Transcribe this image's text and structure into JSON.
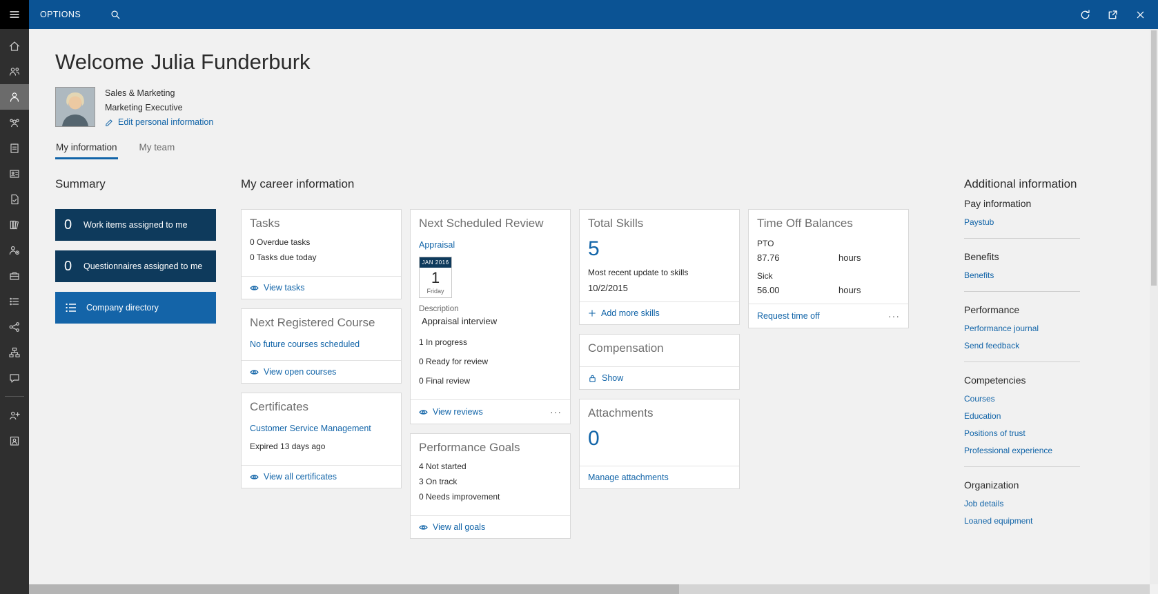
{
  "colors": {
    "topbar": "#0b5394",
    "sidebar": "#2f2f2f",
    "accent": "#1164a8",
    "tile_dark": "#0e3a5c",
    "tile_blue": "#1464a8",
    "background": "#f1f1f1"
  },
  "topbar": {
    "options_label": "OPTIONS"
  },
  "header": {
    "welcome": "Welcome",
    "user_name": "Julia Funderburk"
  },
  "profile": {
    "department": "Sales & Marketing",
    "job_title": "Marketing Executive",
    "edit_link": "Edit personal information"
  },
  "tabs": [
    {
      "label": "My information"
    },
    {
      "label": "My team"
    }
  ],
  "summary": {
    "heading": "Summary",
    "tiles": [
      {
        "count": "0",
        "label": "Work items assigned to me"
      },
      {
        "count": "0",
        "label": "Questionnaires assigned to me"
      },
      {
        "count": "",
        "label": "Company directory"
      }
    ]
  },
  "career": {
    "heading": "My career information",
    "tasks": {
      "title": "Tasks",
      "lines": [
        "0 Overdue tasks",
        "0 Tasks due today"
      ],
      "footer": "View tasks"
    },
    "next_course": {
      "title": "Next Registered Course",
      "link": "No future courses scheduled",
      "footer": "View open courses"
    },
    "certificates": {
      "title": "Certificates",
      "link": "Customer Service Management",
      "line": "Expired 13 days ago",
      "footer": "View all certificates"
    },
    "review": {
      "title": "Next Scheduled Review",
      "link": "Appraisal",
      "calendar": {
        "month": "JAN 2016",
        "day": "1",
        "weekday": "Friday"
      },
      "description_label": "Description",
      "description": "Appraisal interview",
      "lines": [
        "1 In progress",
        "0 Ready for review",
        "0 Final review"
      ],
      "footer": "View reviews",
      "more": "···"
    },
    "goals": {
      "title": "Performance Goals",
      "lines": [
        "4 Not started",
        "3 On track",
        "0 Needs improvement"
      ],
      "footer": "View all goals"
    },
    "skills": {
      "title": "Total Skills",
      "count": "5",
      "line": "Most recent update to skills",
      "date": "10/2/2015",
      "footer": "Add more skills"
    },
    "compensation": {
      "title": "Compensation",
      "footer": "Show"
    },
    "attachments": {
      "title": "Attachments",
      "count": "0",
      "footer": "Manage attachments"
    },
    "timeoff": {
      "title": "Time Off Balances",
      "rows": [
        {
          "label": "PTO",
          "value": "87.76",
          "unit": "hours"
        },
        {
          "label": "Sick",
          "value": "56.00",
          "unit": "hours"
        }
      ],
      "footer": "Request time off",
      "more": "···"
    }
  },
  "additional": {
    "heading": "Additional information",
    "groups": [
      {
        "title": "Pay information",
        "links": [
          {
            "label": "Paystub"
          }
        ]
      },
      {
        "title": "Benefits",
        "links": [
          {
            "label": "Benefits"
          }
        ]
      },
      {
        "title": "Performance",
        "links": [
          {
            "label": "Performance journal"
          },
          {
            "label": "Send feedback"
          }
        ]
      },
      {
        "title": "Competencies",
        "links": [
          {
            "label": "Courses"
          },
          {
            "label": "Education"
          },
          {
            "label": "Positions of trust"
          },
          {
            "label": "Professional experience"
          }
        ]
      },
      {
        "title": "Organization",
        "links": [
          {
            "label": "Job details"
          },
          {
            "label": "Loaned equipment"
          }
        ]
      }
    ]
  }
}
